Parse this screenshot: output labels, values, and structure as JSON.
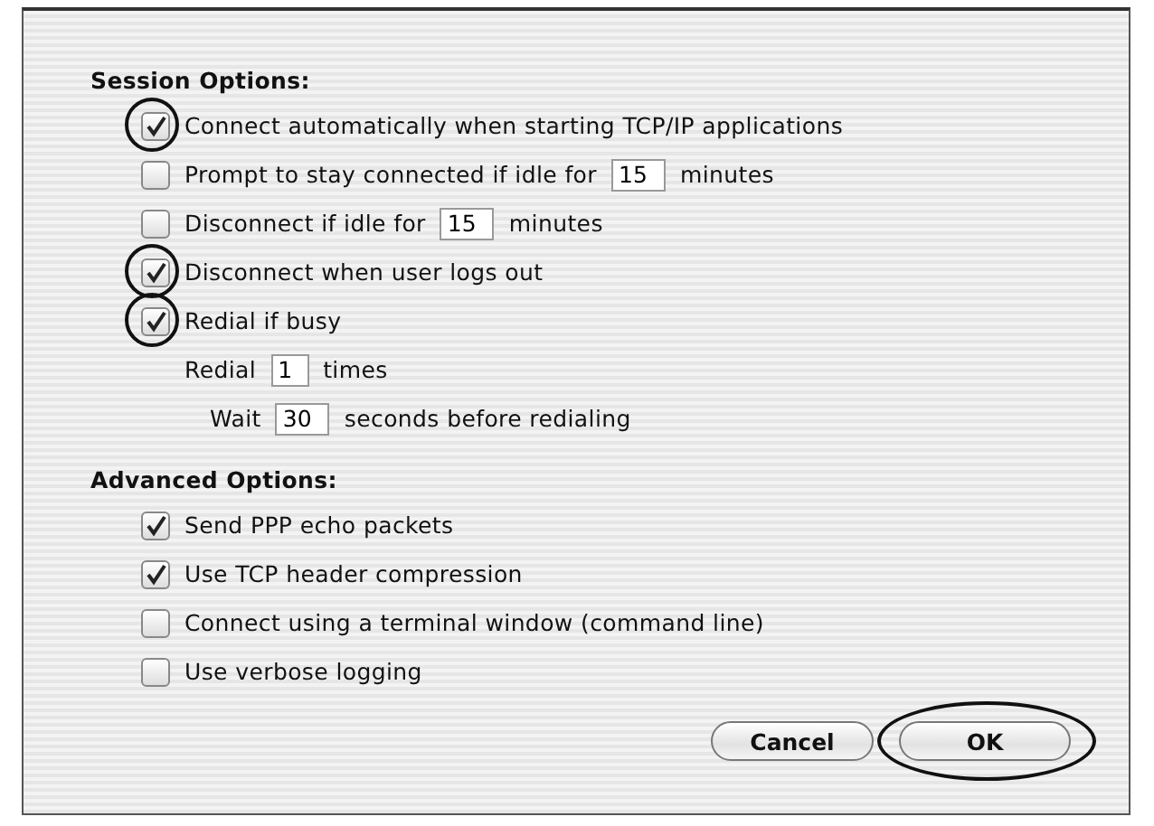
{
  "sections": [
    {
      "heading": "Session Options:",
      "items": [
        {
          "kind": "checkbox",
          "checked": true,
          "annotated": true,
          "label": "Connect automatically when starting TCP/IP applications"
        },
        {
          "kind": "checkbox",
          "checked": false,
          "annotated": false,
          "label": "Prompt to stay connected if idle for",
          "value": "15",
          "suffix": "minutes"
        },
        {
          "kind": "checkbox",
          "checked": false,
          "annotated": false,
          "label": "Disconnect if idle for",
          "value": "15",
          "suffix": "minutes"
        },
        {
          "kind": "checkbox",
          "checked": true,
          "annotated": true,
          "label": "Disconnect when user logs out"
        },
        {
          "kind": "checkbox",
          "checked": true,
          "annotated": true,
          "label": "Redial if busy",
          "children": [
            {
              "kind": "field",
              "label": "Redial",
              "value": "1",
              "suffix": "times",
              "children": [
                {
                  "kind": "field",
                  "label": "Wait",
                  "value": "30",
                  "suffix": "seconds before redialing"
                }
              ]
            }
          ]
        }
      ]
    },
    {
      "heading": "Advanced Options:",
      "items": [
        {
          "kind": "checkbox",
          "checked": true,
          "annotated": false,
          "label": "Send PPP echo packets"
        },
        {
          "kind": "checkbox",
          "checked": true,
          "annotated": false,
          "label": "Use TCP header compression"
        },
        {
          "kind": "checkbox",
          "checked": false,
          "annotated": false,
          "label": "Connect using a terminal window (command line)"
        },
        {
          "kind": "checkbox",
          "checked": false,
          "annotated": false,
          "label": "Use verbose logging"
        }
      ]
    }
  ],
  "buttons": [
    {
      "label": "Cancel",
      "annotated": false
    },
    {
      "label": "OK",
      "annotated": true
    }
  ]
}
